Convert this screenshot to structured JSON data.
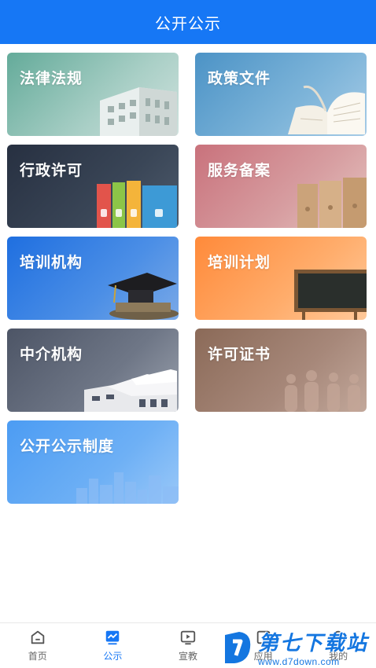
{
  "header": {
    "title": "公开公示"
  },
  "cards": [
    {
      "label": "法律法规"
    },
    {
      "label": "政策文件"
    },
    {
      "label": "行政许可"
    },
    {
      "label": "服务备案"
    },
    {
      "label": "培训机构"
    },
    {
      "label": "培训计划"
    },
    {
      "label": "中介机构"
    },
    {
      "label": "许可证书"
    },
    {
      "label": "公开公示制度"
    }
  ],
  "tabbar": {
    "items": [
      {
        "label": "首页",
        "icon": "home-icon"
      },
      {
        "label": "公示",
        "icon": "chart-icon",
        "active": true
      },
      {
        "label": "宣教",
        "icon": "video-icon"
      },
      {
        "label": "应用",
        "icon": "apps-icon"
      },
      {
        "label": "我的",
        "icon": "user-icon"
      }
    ]
  },
  "watermark": {
    "title": "第七下载站",
    "url": "www.d7down.com"
  },
  "colors": {
    "primary": "#1677f5"
  }
}
